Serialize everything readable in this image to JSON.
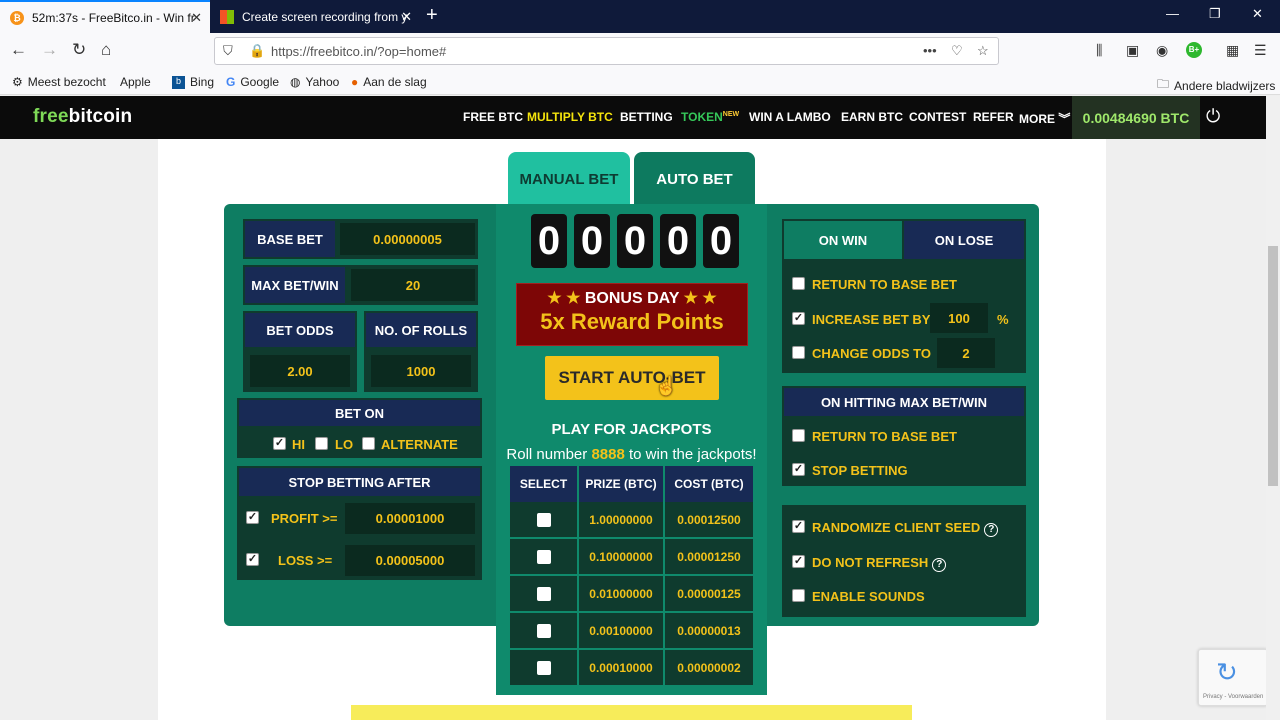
{
  "browser": {
    "tabs": [
      {
        "title": "52m:37s - FreeBitco.in - Win fr",
        "active": true
      },
      {
        "title": "Create screen recording from y",
        "active": false
      }
    ],
    "url": "https://freebitco.in/?op=home#",
    "bookmarks": [
      "Meest bezocht",
      "Apple",
      "Bing",
      "Google",
      "Yahoo",
      "Aan de slag"
    ],
    "other_bookmarks": "Andere bladwijzers"
  },
  "site": {
    "logo_free": "free",
    "logo_bitcoin": "bitcoin",
    "nav": [
      "FREE BTC",
      "MULTIPLY BTC",
      "BETTING",
      "TOKEN",
      "WIN A LAMBO",
      "EARN BTC",
      "CONTEST",
      "REFER",
      "MORE"
    ],
    "token_badge": "NEW",
    "balance": "0.00484690 BTC"
  },
  "tabs": {
    "manual": "MANUAL BET",
    "auto": "AUTO BET"
  },
  "left": {
    "base_bet_label": "BASE BET",
    "base_bet_value": "0.00000005",
    "max_bet_label": "MAX BET/WIN",
    "max_bet_value": "20",
    "bet_odds_label": "BET ODDS",
    "bet_odds_value": "2.00",
    "rolls_label": "NO. OF ROLLS",
    "rolls_value": "1000",
    "bet_on_label": "BET ON",
    "bet_on_hi": "HI",
    "bet_on_lo": "LO",
    "bet_on_alt": "ALTERNATE",
    "stop_label": "STOP BETTING AFTER",
    "profit_label": "PROFIT >=",
    "profit_value": "0.00001000",
    "loss_label": "LOSS >=",
    "loss_value": "0.00005000"
  },
  "center": {
    "digits": [
      "0",
      "0",
      "0",
      "0",
      "0"
    ],
    "bonus_line1": "BONUS DAY",
    "bonus_line2": "5x Reward Points",
    "start_button": "START AUTO-BET",
    "jackpot_title": "PLAY FOR JACKPOTS",
    "jackpot_sub_pre": "Roll number",
    "jackpot_number": "8888",
    "jackpot_sub_post": "to win the jackpots!",
    "table_headers": [
      "SELECT",
      "PRIZE (BTC)",
      "COST (BTC)"
    ],
    "rows": [
      {
        "prize": "1.00000000",
        "cost": "0.00012500"
      },
      {
        "prize": "0.10000000",
        "cost": "0.00001250"
      },
      {
        "prize": "0.01000000",
        "cost": "0.00000125"
      },
      {
        "prize": "0.00100000",
        "cost": "0.00000013"
      },
      {
        "prize": "0.00010000",
        "cost": "0.00000002"
      }
    ]
  },
  "right": {
    "on_win": "ON WIN",
    "on_lose": "ON LOSE",
    "return_base": "RETURN TO BASE BET",
    "increase_bet": "INCREASE BET BY",
    "increase_value": "100",
    "percent": "%",
    "change_odds": "CHANGE ODDS TO",
    "change_odds_value": "2",
    "max_hit_label": "ON HITTING MAX BET/WIN",
    "max_return_base": "RETURN TO BASE BET",
    "stop_betting": "STOP BETTING",
    "randomize": "RANDOMIZE CLIENT SEED",
    "no_refresh": "DO NOT REFRESH",
    "sounds": "ENABLE SOUNDS"
  },
  "recaptcha_text": "Privacy - Voorwaarden"
}
